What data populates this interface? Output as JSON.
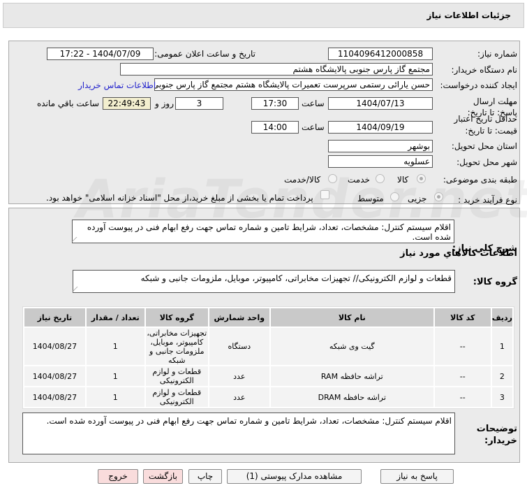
{
  "title": "جزئیات اطلاعات نیاز",
  "watermark": "AriaTender.net",
  "form": {
    "need_number_label": "شماره نیاز:",
    "need_number": "1104096412000858",
    "announce_label": "تاریخ و ساعت اعلان عمومی:",
    "announce_value": "1404/07/09 - 17:22",
    "buyer_label": "نام دستگاه خریدار:",
    "buyer": "مجتمع گاز پارس جنوبی  پالایشگاه هشتم",
    "creator_label": "ایجاد کننده درخواست:",
    "creator": "حسن یارائی رستمی سرپرست تعمیرات پالایشگاه هشتم مجتمع گاز پارس جنوبی",
    "contact_link": "اطلاعات تماس خریدار",
    "deadline_label": "مهلت ارسال پاسخ: تا تاریخ:",
    "deadline_date": "1404/07/13",
    "time_label": "ساعت",
    "deadline_time": "17:30",
    "days": "3",
    "days_label": "روز و",
    "remaining": "22:49:43",
    "remaining_label": "ساعت باقي مانده",
    "validity_label": "حداقل تاریخ اعتبار قیمت: تا تاریخ:",
    "validity_date": "1404/09/19",
    "validity_time": "14:00",
    "province_label": "استان محل تحویل:",
    "province": "بوشهر",
    "city_label": "شهر محل تحویل:",
    "city": "عسلویه",
    "category_label": "طبقه بندی موضوعی:",
    "category_options": [
      "کالا",
      "خدمت",
      "کالا/خدمت"
    ],
    "process_label": "نوع فرآیند خرید :",
    "process_options": [
      "جزیی",
      "متوسط"
    ],
    "payment_note": "پرداخت تمام یا بخشی از مبلغ خرید،از محل \"اسناد خزانه اسلامی\" خواهد بود."
  },
  "description_label": "شرح کلي نیاز:",
  "description": "اقلام سیستم کنترل: مشخصات، تعداد، شرایط تامین و شماره تماس جهت رفع ابهام فنی در پیوست آورده شده است.",
  "goods_info_title": "اطلاعات کالاهاي مورد نیاز",
  "group_label": "گروه کالا:",
  "group": "قطعات و لوازم الکترونیکی// تجهیزات مخابراتی، کامپیوتر، موبایل، ملزومات جانبی و شبکه",
  "table": {
    "headers": [
      "ردیف",
      "کد کالا",
      "نام کالا",
      "واحد شمارش",
      "گروه کالا",
      "تعداد / مقدار",
      "تاریخ نیاز"
    ],
    "rows": [
      [
        "1",
        "--",
        "گیت وی شبکه",
        "دستگاه",
        "تجهیزات مخابراتی، کامپیوتر، موبایل، ملزومات جانبی و شبکه",
        "1",
        "1404/08/27"
      ],
      [
        "2",
        "--",
        "تراشه حافظه RAM",
        "عدد",
        "قطعات و لوازم الکترونیکی",
        "1",
        "1404/08/27"
      ],
      [
        "3",
        "--",
        "تراشه حافظه DRAM",
        "عدد",
        "قطعات و لوازم الکترونیکی",
        "1",
        "1404/08/27"
      ]
    ]
  },
  "buyer_notes_label": "توضیحات خریدار:",
  "buyer_notes": "اقلام سیستم کنترل: مشخصات، تعداد، شرایط تامین و شماره تماس جهت رفع ابهام فنی در پیوست آورده شده است.",
  "buttons": {
    "reply": "پاسخ به نیاز",
    "attachments": "مشاهده مدارک پیوستی (1)",
    "print": "چاپ",
    "back": "بازگشت",
    "exit": "خروج"
  }
}
